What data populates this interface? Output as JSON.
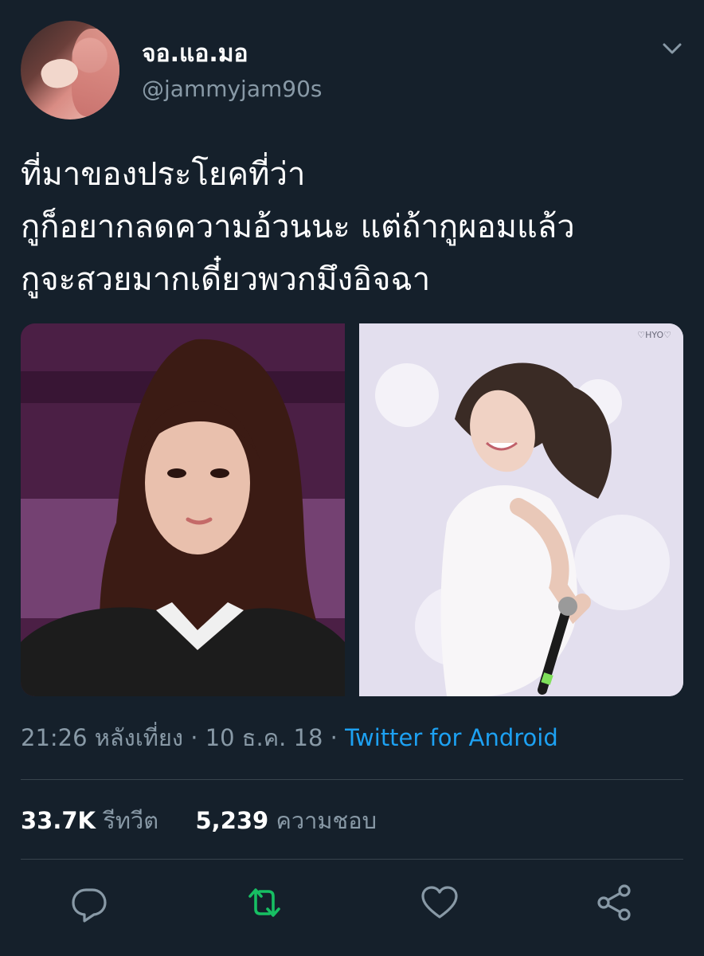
{
  "author": {
    "display_name": "จอ.แอ.มอ",
    "handle": "@jammyjam90s"
  },
  "tweet": {
    "lines": [
      "ที่มาของประโยคที่ว่า",
      "กูก็อยากลดความอ้วนนะ แต่ถ้ากูผอมแล้ว",
      "กูจะสวยมากเดี๋ยวพวกมึงอิจฉา"
    ]
  },
  "media": {
    "watermark": "♡HYO♡"
  },
  "meta": {
    "time": "21:26 หลังเที่ยง",
    "separator": " · ",
    "date": "10 ธ.ค. 18",
    "source": "Twitter for Android"
  },
  "stats": {
    "retweets_count": "33.7K",
    "retweets_label": "รีทวีต",
    "likes_count": "5,239",
    "likes_label": "ความชอบ"
  },
  "icons": {
    "reply": "reply-icon",
    "retweet": "retweet-icon",
    "like": "heart-icon",
    "share": "share-icon",
    "menu": "chevron-down-icon"
  },
  "colors": {
    "background": "#15202b",
    "text": "#ffffff",
    "muted": "#8899a6",
    "link": "#1da1f2",
    "retweet_active": "#17bf63",
    "divider": "#38444d"
  }
}
